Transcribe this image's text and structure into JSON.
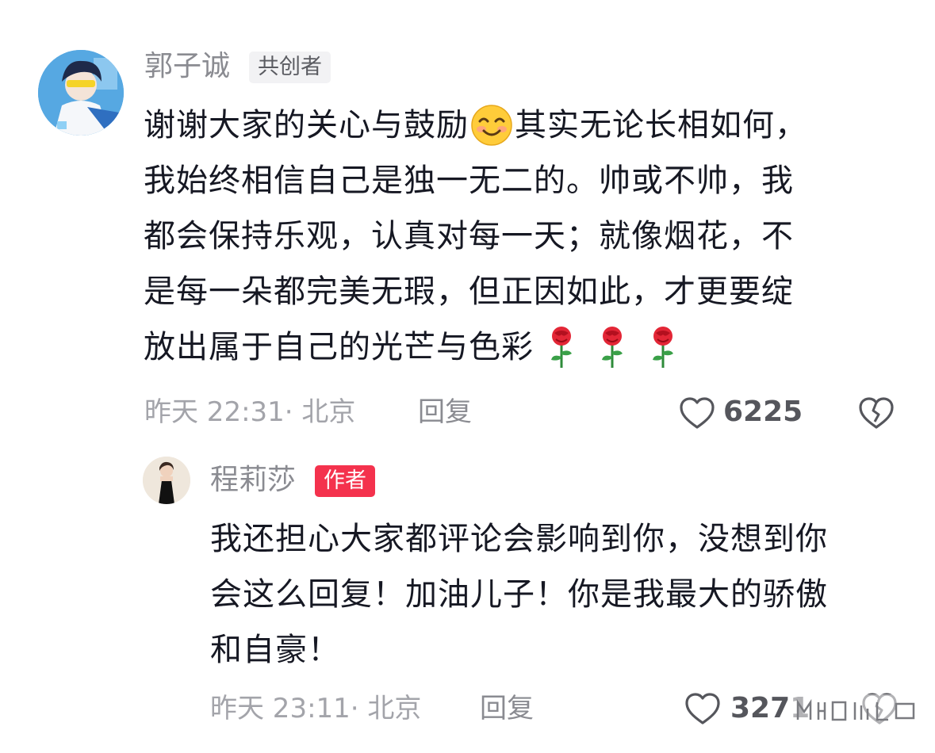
{
  "comment": {
    "author": "郭子诚",
    "badge": "共创者",
    "lines": [
      "谢谢大家的关心与鼓励",
      "其实无论长相如何，",
      "我始终相信自己是独一无二的。帅或不帅，我",
      "都会保持乐观，认真对每一天；就像烟花，不",
      "是每一朵都完美无瑕，但正因如此，才更要绽",
      "放出属于自己的光芒与色彩"
    ],
    "emoji_inline": "smiling-face-emoji",
    "emoji_trailing": [
      "rose-emoji",
      "rose-emoji",
      "rose-emoji"
    ],
    "time_location": "昨天 22:31· 北京",
    "reply_label": "回复",
    "likes": "6225"
  },
  "reply": {
    "author": "程莉莎",
    "badge": "作者",
    "lines": [
      "我还担心大家都评论会影响到你，没想到你",
      "会这么回复！加油儿子！你是我最大的骄傲",
      "和自豪！"
    ],
    "time_location": "昨天 23:11· 北京",
    "reply_label": "回复",
    "likes": "3271"
  },
  "colors": {
    "author_badge": "#f4324d",
    "text": "#161823",
    "meta": "#a3a4aa"
  },
  "icons": [
    "heart-outline-icon",
    "broken-heart-icon"
  ]
}
